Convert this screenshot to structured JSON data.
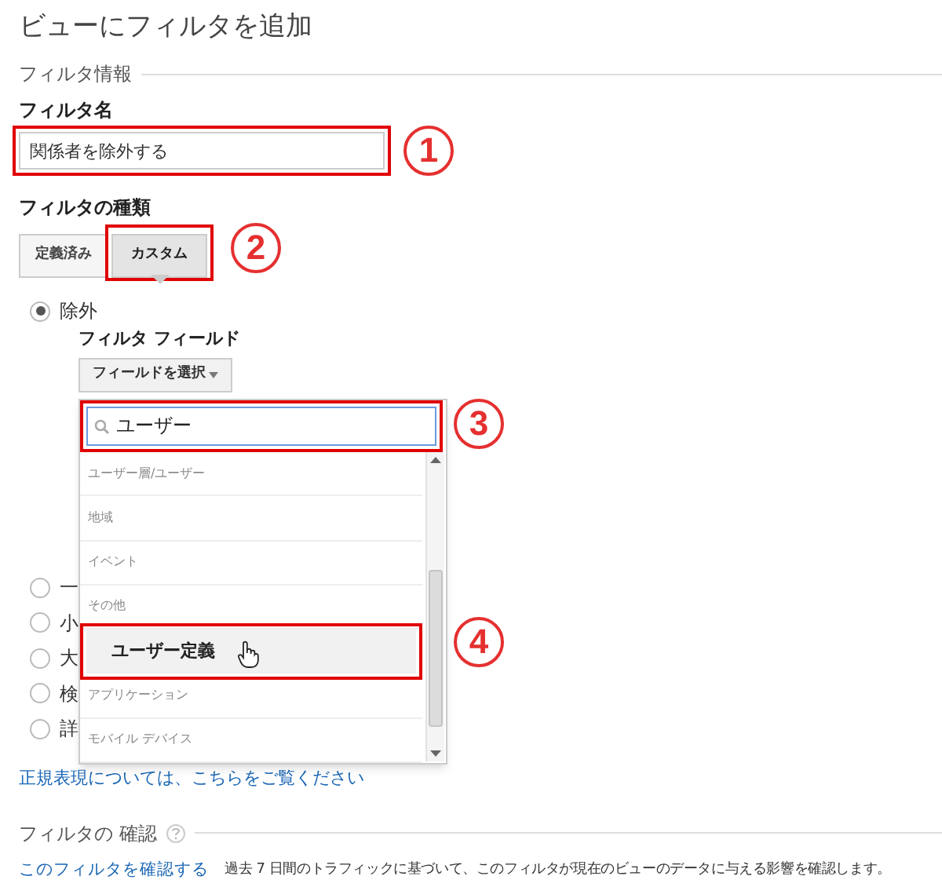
{
  "title": "ビューにフィルタを追加",
  "filter_info": {
    "heading": "フィルタ情報",
    "name_label": "フィルタ名",
    "name_value": "関係者を除外する",
    "name_highlighted": true,
    "name_callout": "1"
  },
  "filter_type": {
    "label": "フィルタの種類",
    "callout": "2",
    "tabs": [
      {
        "label": "定義済み",
        "selected": false,
        "highlighted": false
      },
      {
        "label": "カスタム",
        "selected": true,
        "highlighted": true
      }
    ]
  },
  "options": [
    {
      "label": "除外",
      "checked": true
    },
    {
      "label": "一",
      "checked": false
    },
    {
      "label": "小",
      "checked": false
    },
    {
      "label": "大",
      "checked": false
    },
    {
      "label": "検",
      "checked": false
    },
    {
      "label": "詳",
      "checked": false
    }
  ],
  "filter_field": {
    "label": "フィルタ フィールド",
    "button": "フィールドを選択"
  },
  "dropdown": {
    "search_value": "ユーザー",
    "search_highlighted": true,
    "search_callout": "3",
    "item_callout": "4",
    "items": [
      {
        "label": "ユーザー層/ユーザー",
        "selected": false
      },
      {
        "label": "地域",
        "selected": false
      },
      {
        "label": "イベント",
        "selected": false
      },
      {
        "label": "その他",
        "selected": false
      },
      {
        "label": "ユーザー定義",
        "selected": true
      },
      {
        "label": "アプリケーション",
        "selected": false
      },
      {
        "label": "モバイル デバイス",
        "selected": false
      }
    ]
  },
  "regex_link": "正規表現については、こちらをご覧ください",
  "verify": {
    "heading": "フィルタの 確認",
    "link": "このフィルタを確認する",
    "description": "過去 7 日間のトラフィックに基づいて、このフィルタが現在のビューのデータに与える影響を確認します。"
  }
}
